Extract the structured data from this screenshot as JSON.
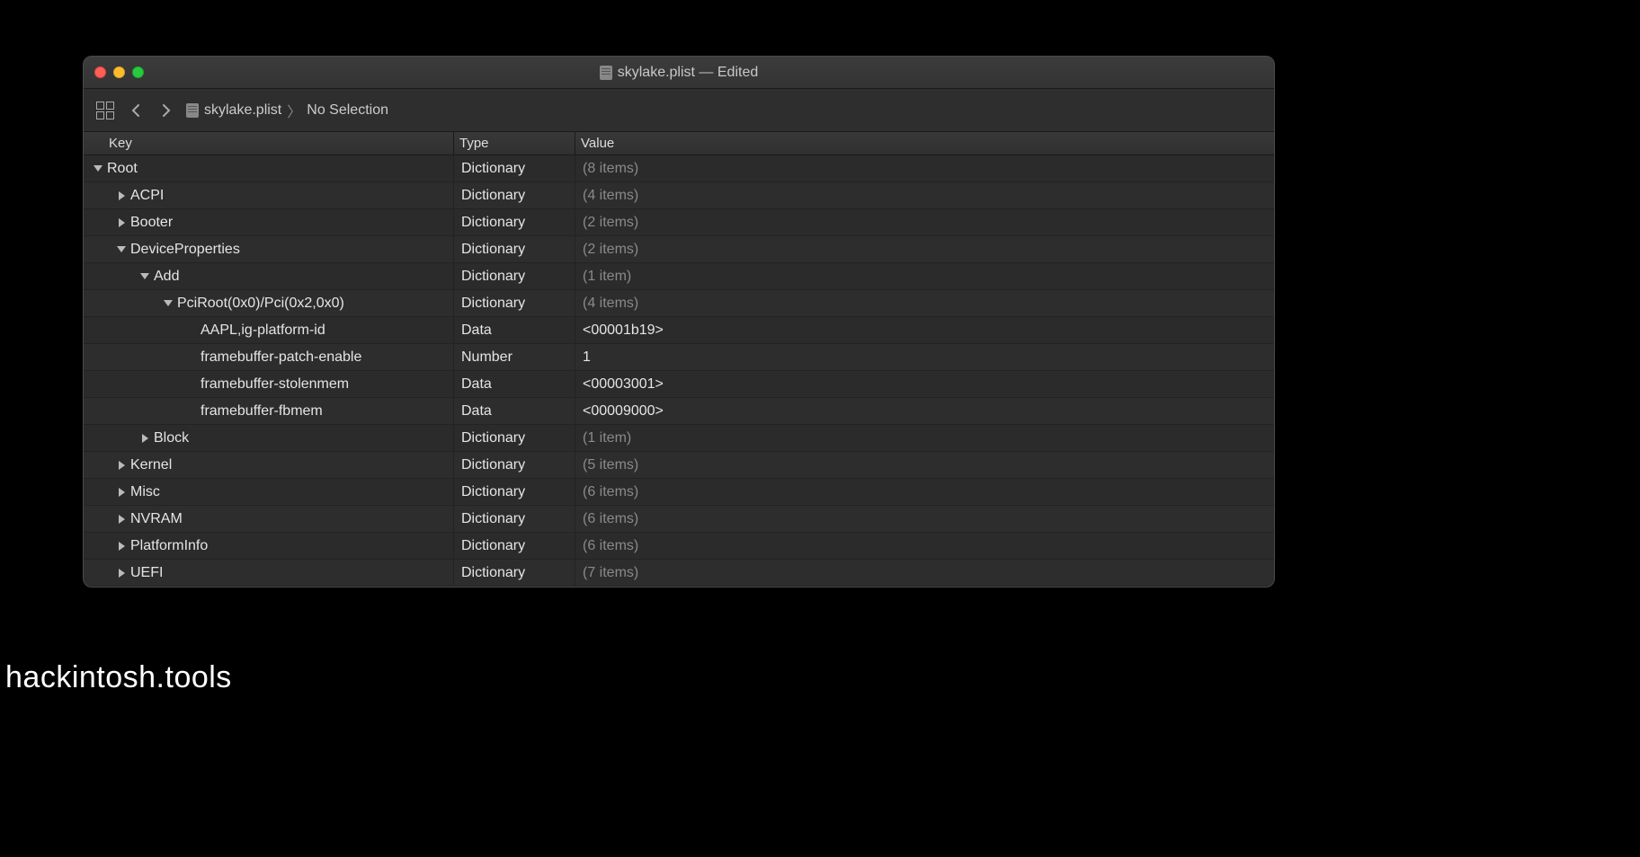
{
  "title": "skylake.plist — Edited",
  "breadcrumb": {
    "file": "skylake.plist",
    "selection": "No Selection"
  },
  "columns": {
    "key": "Key",
    "type": "Type",
    "value": "Value"
  },
  "rows": [
    {
      "indent": 0,
      "disclosure": "down",
      "key": "Root",
      "type": "Dictionary",
      "value": "(8 items)",
      "dim": true
    },
    {
      "indent": 1,
      "disclosure": "right",
      "key": "ACPI",
      "type": "Dictionary",
      "value": "(4 items)",
      "dim": true
    },
    {
      "indent": 1,
      "disclosure": "right",
      "key": "Booter",
      "type": "Dictionary",
      "value": "(2 items)",
      "dim": true
    },
    {
      "indent": 1,
      "disclosure": "down",
      "key": "DeviceProperties",
      "type": "Dictionary",
      "value": "(2 items)",
      "dim": true
    },
    {
      "indent": 2,
      "disclosure": "down",
      "key": "Add",
      "type": "Dictionary",
      "value": "(1 item)",
      "dim": true
    },
    {
      "indent": 3,
      "disclosure": "down",
      "key": "PciRoot(0x0)/Pci(0x2,0x0)",
      "type": "Dictionary",
      "value": "(4 items)",
      "dim": true
    },
    {
      "indent": 4,
      "disclosure": "none",
      "key": "AAPL,ig-platform-id",
      "type": "Data",
      "value": "<00001b19>",
      "dim": false
    },
    {
      "indent": 4,
      "disclosure": "none",
      "key": "framebuffer-patch-enable",
      "type": "Number",
      "value": "1",
      "dim": false
    },
    {
      "indent": 4,
      "disclosure": "none",
      "key": "framebuffer-stolenmem",
      "type": "Data",
      "value": "<00003001>",
      "dim": false
    },
    {
      "indent": 4,
      "disclosure": "none",
      "key": "framebuffer-fbmem",
      "type": "Data",
      "value": "<00009000>",
      "dim": false
    },
    {
      "indent": 2,
      "disclosure": "right",
      "key": "Block",
      "type": "Dictionary",
      "value": "(1 item)",
      "dim": true
    },
    {
      "indent": 1,
      "disclosure": "right",
      "key": "Kernel",
      "type": "Dictionary",
      "value": "(5 items)",
      "dim": true
    },
    {
      "indent": 1,
      "disclosure": "right",
      "key": "Misc",
      "type": "Dictionary",
      "value": "(6 items)",
      "dim": true
    },
    {
      "indent": 1,
      "disclosure": "right",
      "key": "NVRAM",
      "type": "Dictionary",
      "value": "(6 items)",
      "dim": true
    },
    {
      "indent": 1,
      "disclosure": "right",
      "key": "PlatformInfo",
      "type": "Dictionary",
      "value": "(6 items)",
      "dim": true
    },
    {
      "indent": 1,
      "disclosure": "right",
      "key": "UEFI",
      "type": "Dictionary",
      "value": "(7 items)",
      "dim": true
    }
  ],
  "watermark": "hackintosh.tools"
}
